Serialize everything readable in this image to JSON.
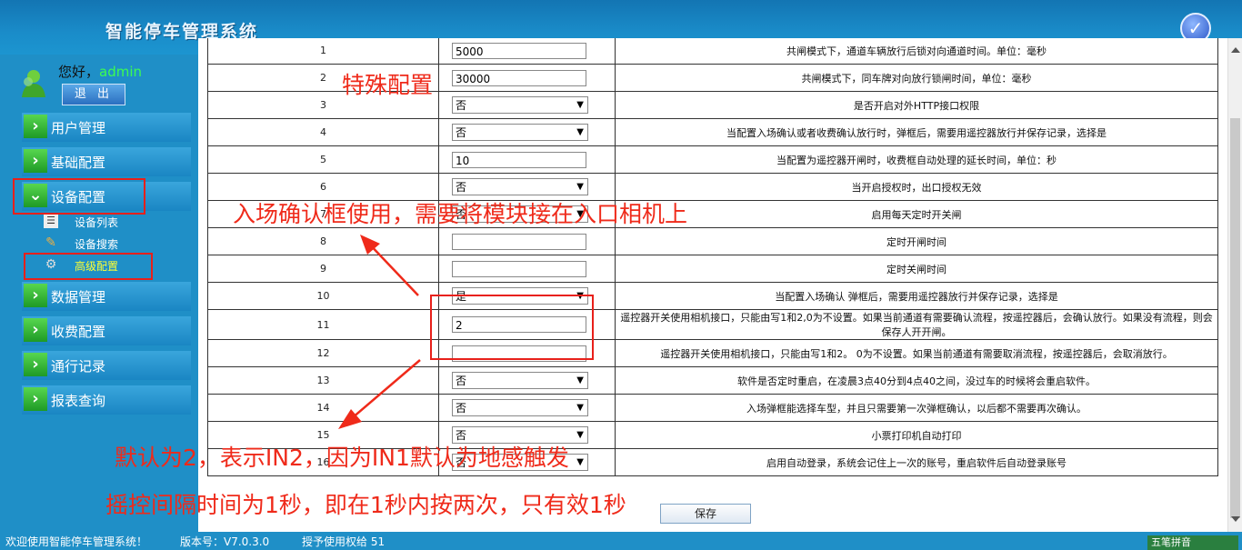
{
  "header": {
    "app_title": "智能停车管理系统"
  },
  "user": {
    "greeting": "您好，",
    "name": "admin",
    "logout_label": "退 出"
  },
  "sidebar": {
    "menu": [
      {
        "label": "用户管理"
      },
      {
        "label": "基础配置"
      },
      {
        "label": "设备配置"
      },
      {
        "label": "数据管理"
      },
      {
        "label": "收费配置"
      },
      {
        "label": "通行记录"
      },
      {
        "label": "报表查询"
      }
    ],
    "submenu": [
      {
        "label": "设备列表"
      },
      {
        "label": "设备搜索"
      },
      {
        "label": "高级配置"
      }
    ]
  },
  "table": {
    "rows": [
      {
        "num": "1",
        "type": "input",
        "value": "5000",
        "desc": "共闸模式下，通道车辆放行后锁对向通道时间。单位：毫秒"
      },
      {
        "num": "2",
        "type": "input",
        "value": "30000",
        "desc": "共闸模式下，同车牌对向放行锁闸时间，单位：毫秒"
      },
      {
        "num": "3",
        "type": "select",
        "value": "否",
        "desc": "是否开启对外HTTP接口权限"
      },
      {
        "num": "4",
        "type": "select",
        "value": "否",
        "desc": "当配置入场确认或者收费确认放行时，弹框后，需要用遥控器放行并保存记录，选择是"
      },
      {
        "num": "5",
        "type": "input",
        "value": "10",
        "desc": "当配置为遥控器开闸时，收费框自动处理的延长时间，单位：秒"
      },
      {
        "num": "6",
        "type": "select",
        "value": "否",
        "desc": "当开启授权时，出口授权无效"
      },
      {
        "num": "7",
        "type": "select",
        "value": "否",
        "desc": "启用每天定时开关闸"
      },
      {
        "num": "8",
        "type": "input",
        "value": "",
        "desc": "定时开闸时间"
      },
      {
        "num": "9",
        "type": "input",
        "value": "",
        "desc": "定时关闸时间"
      },
      {
        "num": "10",
        "type": "select",
        "value": "是",
        "desc": "当配置入场确认 弹框后，需要用遥控器放行并保存记录，选择是"
      },
      {
        "num": "11",
        "type": "input",
        "value": "2",
        "desc": "遥控器开关使用相机接口，只能由写1和2,0为不设置。如果当前通道有需要确认流程，按遥控器后，会确认放行。如果没有流程，则会保存人开开闸。"
      },
      {
        "num": "12",
        "type": "input",
        "value": "",
        "desc": "遥控器开关使用相机接口，只能由写1和2。 0为不设置。如果当前通道有需要取消流程，按遥控器后，会取消放行。"
      },
      {
        "num": "13",
        "type": "select",
        "value": "否",
        "desc": "软件是否定时重启，在凌晨3点40分到4点40之间，没过车的时候将会重启软件。"
      },
      {
        "num": "14",
        "type": "select",
        "value": "否",
        "desc": "入场弹框能选择车型，并且只需要第一次弹框确认，以后都不需要再次确认。"
      },
      {
        "num": "15",
        "type": "select",
        "value": "否",
        "desc": "小票打印机自动打印"
      },
      {
        "num": "16",
        "type": "select",
        "value": "否",
        "desc": "启用自动登录，系统会记住上一次的账号，重启软件后自动登录账号"
      }
    ],
    "save_label": "保存"
  },
  "annotations": {
    "special": "特殊配置",
    "entry_confirm": "入场确认框使用，需要将模块接在入口相机上",
    "default_in2": "默认为2，表示IN2，因为IN1默认为地感触发",
    "interval": "摇控间隔时间为1秒，即在1秒内按两次，只有效1秒"
  },
  "footer": {
    "welcome": "欢迎使用智能停车管理系统！",
    "version": "版本号：V7.0.3.0",
    "license": "授予使用权给 51",
    "ime": "五笔拼音"
  },
  "colors": {
    "annotation_red": "#ef2a1a",
    "menu_green": "#1e9a26",
    "background_blue": "#1f8fc7",
    "username_green": "#3cfc52"
  },
  "icons": [
    "check-badge-icon",
    "user-avatar-icon",
    "chevron-right-icon",
    "chevron-down-icon",
    "list-icon",
    "wrench-icon",
    "gear-icon"
  ]
}
